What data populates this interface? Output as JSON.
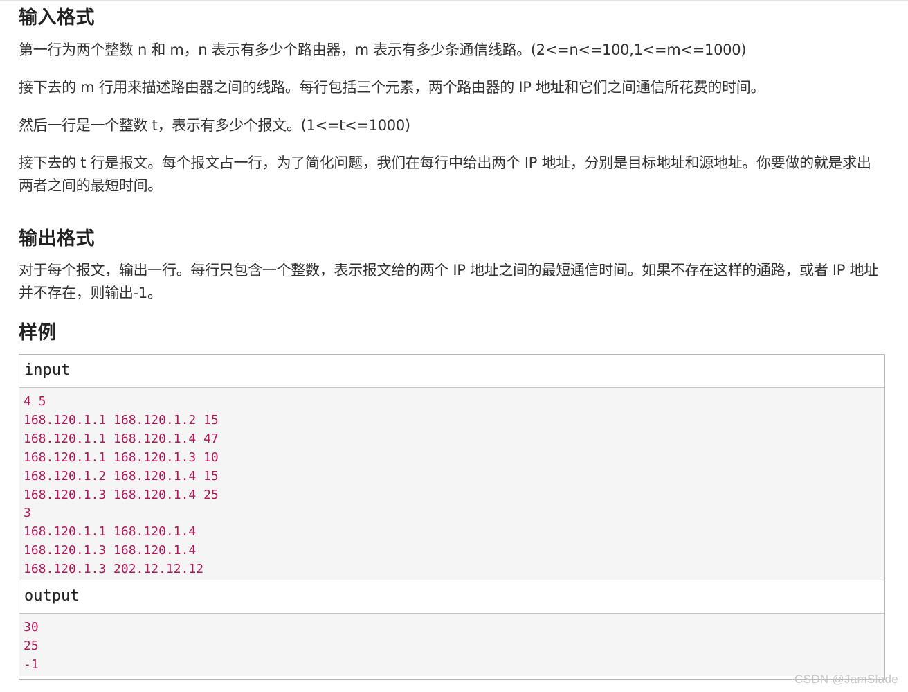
{
  "sections": {
    "input_heading": "输入格式",
    "input_paragraphs": [
      "第一行为两个整数 n 和 m，n 表示有多少个路由器，m 表示有多少条通信线路。(2<=n<=100,1<=m<=1000)",
      "接下去的 m 行用来描述路由器之间的线路。每行包括三个元素，两个路由器的 IP 地址和它们之间通信所花费的时间。",
      "然后一行是一个整数 t，表示有多少个报文。(1<=t<=1000)",
      "接下去的 t 行是报文。每个报文占一行，为了简化问题，我们在每行中给出两个 IP 地址，分别是目标地址和源地址。你要做的就是求出两者之间的最短时间。"
    ],
    "output_heading": "输出格式",
    "output_paragraph": "对于每个报文，输出一行。每行只包含一个整数，表示报文给的两个 IP 地址之间的最短通信时间。如果不存在这样的通路，或者 IP 地址并不存在，则输出-1。",
    "sample_heading": "样例"
  },
  "sample": {
    "input_label": "input",
    "input_lines": [
      "4 5",
      "168.120.1.1 168.120.1.2 15",
      "168.120.1.1 168.120.1.4 47",
      "168.120.1.1 168.120.1.3 10",
      "168.120.1.2 168.120.1.4 15",
      "168.120.1.3 168.120.1.4 25",
      "3",
      "168.120.1.1 168.120.1.4",
      "168.120.1.3 168.120.1.4",
      "168.120.1.3 202.12.12.12"
    ],
    "output_label": "output",
    "output_lines": [
      "30",
      "25",
      "-1"
    ]
  },
  "watermark": "CSDN @JamSlade",
  "colors": {
    "code_text": "#b3175a",
    "code_background": "#f5f5f5",
    "box_border": "#b8b8b8"
  }
}
